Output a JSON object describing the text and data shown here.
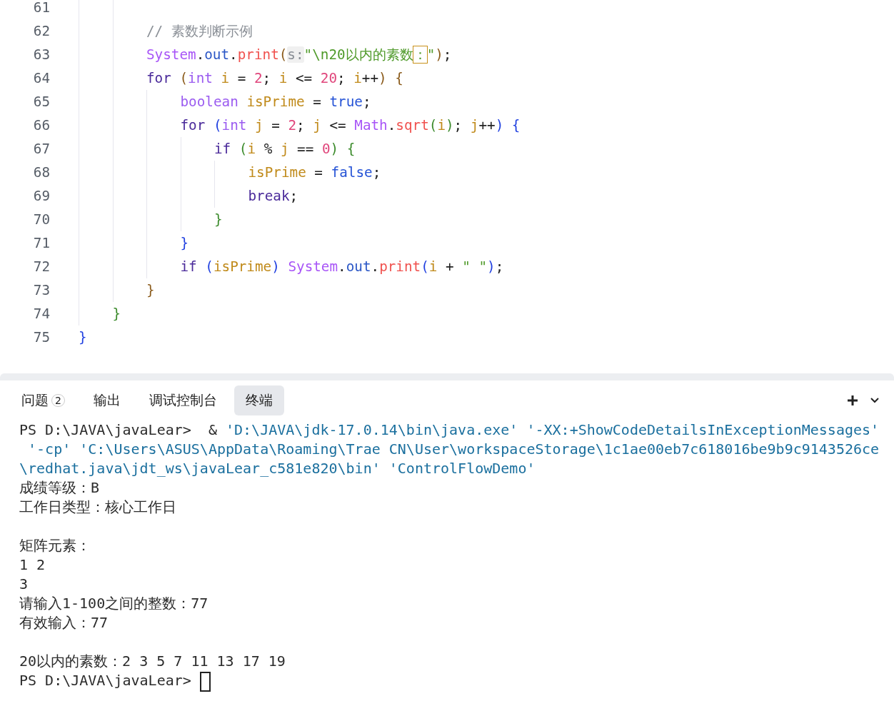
{
  "editor": {
    "blocks": [
      {
        "children": [
          {
            "children": [
              {
                "number": "61"
              },
              {
                "number": "62",
                "tokens": [
                  {
                    "kind": "comment",
                    "text": "// 素数判断示例"
                  }
                ]
              },
              {
                "number": "63",
                "tokens": [
                  {
                    "kind": "class",
                    "text": "System"
                  },
                  {
                    "kind": "punct",
                    "text": "."
                  },
                  {
                    "kind": "field",
                    "text": "out"
                  },
                  {
                    "kind": "punct",
                    "text": "."
                  },
                  {
                    "kind": "method",
                    "text": "print"
                  },
                  {
                    "kind": "bracket1",
                    "text": "("
                  },
                  {
                    "kind": "hint",
                    "text": "s:"
                  },
                  {
                    "kind": "string",
                    "text": "\"\\n20以内的素数"
                  },
                  {
                    "kind": "caret",
                    "text": "："
                  },
                  {
                    "kind": "string",
                    "text": "\""
                  },
                  {
                    "kind": "bracket1",
                    "text": ")"
                  },
                  {
                    "kind": "punct",
                    "text": ";"
                  }
                ]
              },
              {
                "number": "64",
                "tokens": [
                  {
                    "kind": "keyword",
                    "text": "for "
                  },
                  {
                    "kind": "bracket1",
                    "text": "("
                  },
                  {
                    "kind": "type",
                    "text": "int "
                  },
                  {
                    "kind": "var",
                    "text": "i"
                  },
                  {
                    "kind": "punct",
                    "text": " = "
                  },
                  {
                    "kind": "number",
                    "text": "2"
                  },
                  {
                    "kind": "punct",
                    "text": "; "
                  },
                  {
                    "kind": "var",
                    "text": "i"
                  },
                  {
                    "kind": "punct",
                    "text": " <= "
                  },
                  {
                    "kind": "number",
                    "text": "20"
                  },
                  {
                    "kind": "punct",
                    "text": "; "
                  },
                  {
                    "kind": "var",
                    "text": "i"
                  },
                  {
                    "kind": "punct",
                    "text": "++"
                  },
                  {
                    "kind": "bracket1",
                    "text": ")"
                  },
                  {
                    "kind": "bracket1",
                    "text": " {"
                  }
                ]
              },
              {
                "children": [
                  {
                    "number": "65",
                    "tokens": [
                      {
                        "kind": "type",
                        "text": "boolean "
                      },
                      {
                        "kind": "var",
                        "text": "isPrime"
                      },
                      {
                        "kind": "punct",
                        "text": " = "
                      },
                      {
                        "kind": "literal",
                        "text": "true"
                      },
                      {
                        "kind": "punct",
                        "text": ";"
                      }
                    ]
                  },
                  {
                    "number": "66",
                    "tokens": [
                      {
                        "kind": "keyword",
                        "text": "for "
                      },
                      {
                        "kind": "bracket2",
                        "text": "("
                      },
                      {
                        "kind": "type",
                        "text": "int "
                      },
                      {
                        "kind": "var",
                        "text": "j"
                      },
                      {
                        "kind": "punct",
                        "text": " = "
                      },
                      {
                        "kind": "number",
                        "text": "2"
                      },
                      {
                        "kind": "punct",
                        "text": "; "
                      },
                      {
                        "kind": "var",
                        "text": "j"
                      },
                      {
                        "kind": "punct",
                        "text": " <= "
                      },
                      {
                        "kind": "class",
                        "text": "Math"
                      },
                      {
                        "kind": "punct",
                        "text": "."
                      },
                      {
                        "kind": "method",
                        "text": "sqrt"
                      },
                      {
                        "kind": "bracket3",
                        "text": "("
                      },
                      {
                        "kind": "var",
                        "text": "i"
                      },
                      {
                        "kind": "bracket3",
                        "text": ")"
                      },
                      {
                        "kind": "punct",
                        "text": "; "
                      },
                      {
                        "kind": "var",
                        "text": "j"
                      },
                      {
                        "kind": "punct",
                        "text": "++"
                      },
                      {
                        "kind": "bracket2",
                        "text": ")"
                      },
                      {
                        "kind": "bracket2",
                        "text": " {"
                      }
                    ]
                  },
                  {
                    "children": [
                      {
                        "number": "67",
                        "tokens": [
                          {
                            "kind": "keyword",
                            "text": "if "
                          },
                          {
                            "kind": "bracket3",
                            "text": "("
                          },
                          {
                            "kind": "var",
                            "text": "i"
                          },
                          {
                            "kind": "punct",
                            "text": " % "
                          },
                          {
                            "kind": "var",
                            "text": "j"
                          },
                          {
                            "kind": "punct",
                            "text": " == "
                          },
                          {
                            "kind": "number",
                            "text": "0"
                          },
                          {
                            "kind": "bracket3",
                            "text": ")"
                          },
                          {
                            "kind": "bracket3",
                            "text": " {"
                          }
                        ]
                      },
                      {
                        "children": [
                          {
                            "number": "68",
                            "tokens": [
                              {
                                "kind": "var",
                                "text": "isPrime"
                              },
                              {
                                "kind": "punct",
                                "text": " = "
                              },
                              {
                                "kind": "literal",
                                "text": "false"
                              },
                              {
                                "kind": "punct",
                                "text": ";"
                              }
                            ]
                          },
                          {
                            "number": "69",
                            "tokens": [
                              {
                                "kind": "keyword",
                                "text": "break"
                              },
                              {
                                "kind": "punct",
                                "text": ";"
                              }
                            ]
                          }
                        ]
                      },
                      {
                        "number": "70",
                        "tokens": [
                          {
                            "kind": "bracket3",
                            "text": "}"
                          }
                        ]
                      }
                    ]
                  },
                  {
                    "number": "71",
                    "tokens": [
                      {
                        "kind": "bracket2",
                        "text": "}"
                      }
                    ]
                  },
                  {
                    "number": "72",
                    "tokens": [
                      {
                        "kind": "keyword",
                        "text": "if "
                      },
                      {
                        "kind": "bracket2",
                        "text": "("
                      },
                      {
                        "kind": "var",
                        "text": "isPrime"
                      },
                      {
                        "kind": "bracket2",
                        "text": ") "
                      },
                      {
                        "kind": "class",
                        "text": "System"
                      },
                      {
                        "kind": "punct",
                        "text": "."
                      },
                      {
                        "kind": "field",
                        "text": "out"
                      },
                      {
                        "kind": "punct",
                        "text": "."
                      },
                      {
                        "kind": "method",
                        "text": "print"
                      },
                      {
                        "kind": "bracket2",
                        "text": "("
                      },
                      {
                        "kind": "var",
                        "text": "i"
                      },
                      {
                        "kind": "punct",
                        "text": " + "
                      },
                      {
                        "kind": "string",
                        "text": "\" \""
                      },
                      {
                        "kind": "bracket2",
                        "text": ")"
                      },
                      {
                        "kind": "punct",
                        "text": ";"
                      }
                    ]
                  }
                ]
              },
              {
                "number": "73",
                "tokens": [
                  {
                    "kind": "bracket1",
                    "text": "}"
                  }
                ]
              }
            ]
          },
          {
            "number": "74",
            "tokens": [
              {
                "kind": "bracket3",
                "text": "}"
              }
            ]
          }
        ]
      },
      {
        "number": "75",
        "tokens": [
          {
            "kind": "bracket2",
            "text": "}"
          }
        ]
      }
    ]
  },
  "panel": {
    "tabs": [
      {
        "label": "问题",
        "badge": "2",
        "selected": false
      },
      {
        "label": "输出",
        "selected": false
      },
      {
        "label": "调试控制台",
        "selected": false
      },
      {
        "label": "终端",
        "selected": true
      }
    ],
    "terminal": {
      "lines": [
        {
          "kind": "text",
          "segments": [
            {
              "kind": "plain",
              "text": "PS D:\\JAVA\\javaLear>  & "
            },
            {
              "kind": "arg",
              "text": "'D:\\JAVA\\jdk-17.0.14\\bin\\java.exe' '-XX:+ShowCodeDetailsInExceptionMessages'"
            }
          ]
        },
        {
          "kind": "text",
          "segments": [
            {
              "kind": "arg",
              "text": " '-cp' 'C:\\Users\\ASUS\\AppData\\Roaming\\Trae CN\\User\\workspaceStorage\\1c1ae00eb7c618016be9b9c9143526ce"
            }
          ]
        },
        {
          "kind": "text",
          "segments": [
            {
              "kind": "arg",
              "text": "\\redhat.java\\jdt_ws\\javaLear_c581e820\\bin' 'ControlFlowDemo'"
            }
          ]
        },
        {
          "kind": "text",
          "segments": [
            {
              "kind": "plain",
              "text": "成绩等级：B"
            }
          ]
        },
        {
          "kind": "text",
          "segments": [
            {
              "kind": "plain",
              "text": "工作日类型：核心工作日"
            }
          ]
        },
        {
          "kind": "blank"
        },
        {
          "kind": "text",
          "segments": [
            {
              "kind": "plain",
              "text": "矩阵元素："
            }
          ]
        },
        {
          "kind": "text",
          "segments": [
            {
              "kind": "plain",
              "text": "1 2"
            }
          ]
        },
        {
          "kind": "text",
          "segments": [
            {
              "kind": "plain",
              "text": "3"
            }
          ]
        },
        {
          "kind": "text",
          "segments": [
            {
              "kind": "plain",
              "text": "请输入1-100之间的整数：77"
            }
          ]
        },
        {
          "kind": "text",
          "segments": [
            {
              "kind": "plain",
              "text": "有效输入：77"
            }
          ]
        },
        {
          "kind": "blank"
        },
        {
          "kind": "text",
          "segments": [
            {
              "kind": "plain",
              "text": "20以内的素数：2 3 5 7 11 13 17 19"
            }
          ]
        },
        {
          "kind": "text",
          "segments": [
            {
              "kind": "plain",
              "text": "PS D:\\JAVA\\javaLear>"
            },
            {
              "kind": "cursor"
            }
          ]
        }
      ]
    }
  }
}
